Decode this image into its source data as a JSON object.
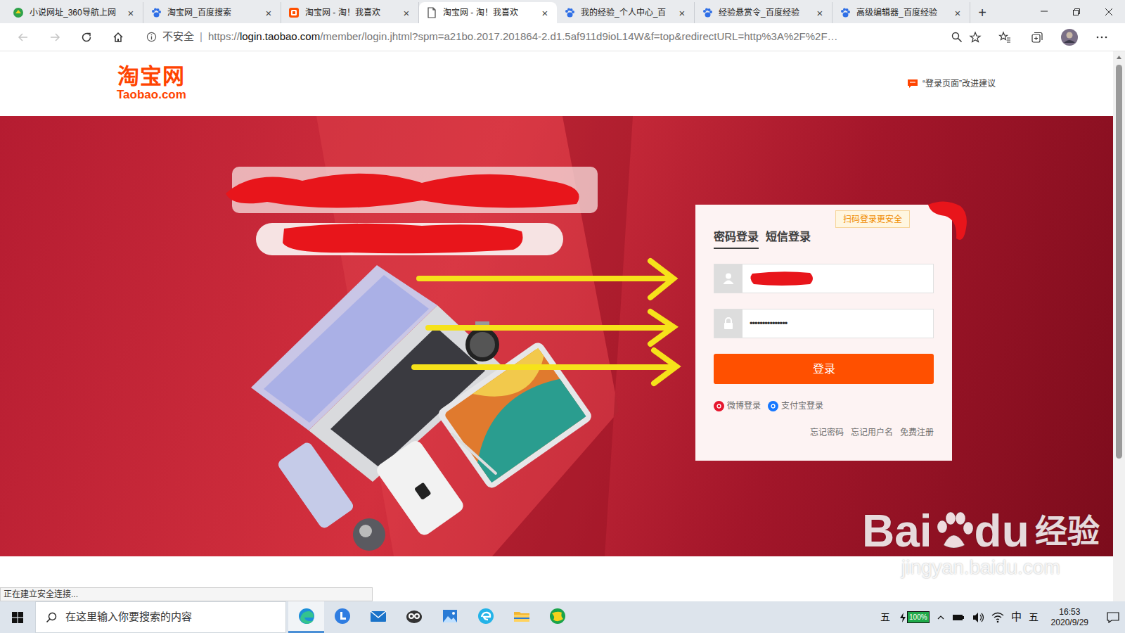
{
  "browser": {
    "tabs": [
      {
        "label": "小说网址_360导航上网",
        "kind": "nav",
        "selected": false,
        "close": "×"
      },
      {
        "label": "淘宝网_百度搜索",
        "kind": "paw",
        "selected": false,
        "close": "×"
      },
      {
        "label": "淘宝网 - 淘！我喜欢",
        "kind": "shop",
        "selected": false,
        "close": "×"
      },
      {
        "label": "淘宝网 - 淘！我喜欢",
        "kind": "blank",
        "selected": true,
        "close": "×"
      },
      {
        "label": "我的经验_个人中心_百",
        "kind": "paw",
        "selected": false,
        "close": "×"
      },
      {
        "label": "经验悬赏令_百度经验",
        "kind": "paw",
        "selected": false,
        "close": "×"
      },
      {
        "label": "高级编辑器_百度经验",
        "kind": "paw",
        "selected": false,
        "close": "×"
      }
    ],
    "new_tab": "+",
    "address_bar": {
      "security": "不安全",
      "separator": "|",
      "url_scheme": "https://",
      "url_host": "login.taobao.com",
      "url_rest": "/member/login.jhtml?spm=a21bo.2017.201864-2.d1.5af911d9ioL14W&f=top&redirectURL=http%3A%2F%2F…"
    },
    "status_text": "正在建立安全连接..."
  },
  "page": {
    "logo": {
      "name": "淘宝网",
      "domain": "Taobao.com"
    },
    "feedback": "“登录页面”改进建议",
    "login": {
      "badge": "扫码登录更安全",
      "tabs": [
        {
          "label": "密码登录",
          "selected": true
        },
        {
          "label": "短信登录",
          "selected": false
        }
      ],
      "password": "•••••••••••••••",
      "submit": "登录",
      "social": [
        {
          "label": "微博登录",
          "color": "#e6162d"
        },
        {
          "label": "支付宝登录",
          "color": "#1677ff"
        }
      ],
      "links": [
        "忘记密码",
        "忘记用户名",
        "免费注册"
      ]
    }
  },
  "watermark": {
    "brand_left": "Bai",
    "brand_right": "du",
    "product": "经验",
    "url": "jingyan.baidu.com"
  },
  "taskbar": {
    "search_placeholder": "在这里输入你要搜索的内容",
    "apps": [
      {
        "kind": "edge",
        "active": true
      },
      {
        "kind": "circle-l",
        "active": false
      },
      {
        "kind": "mail",
        "active": false
      },
      {
        "kind": "owl",
        "active": false
      },
      {
        "kind": "photos",
        "active": false
      },
      {
        "kind": "ie",
        "active": false
      },
      {
        "kind": "folder",
        "active": false
      },
      {
        "kind": "globe",
        "active": false
      }
    ],
    "tray": {
      "ime_left": "五",
      "battery": "100%",
      "lang": "中",
      "ime_right": "五",
      "time": "16:53",
      "date": "2020/9/29"
    }
  }
}
